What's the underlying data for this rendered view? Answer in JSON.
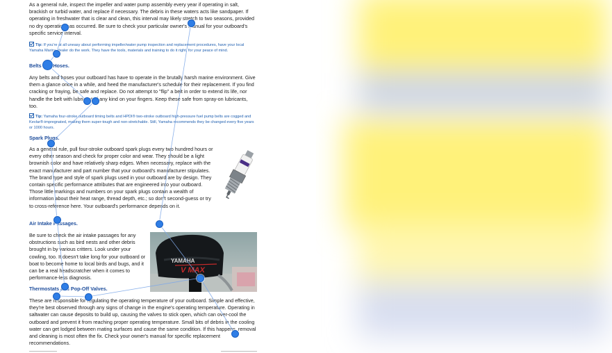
{
  "document": {
    "intro_text": "As a general rule, inspect the impeller and water pump assembly every year if operating in salt, brackish or turbid water, and replace if necessary. The debris in these waters acts like sandpaper. If operating in freshwater that is clear and clean, this interval may likely stretch to two seasons, provided no dry operation has occurred. Be sure to check your particular owner's manual for your outboard's specific service interval.",
    "tip1_label": "Tip:",
    "tip1_text": "If you're at all uneasy about performing impeller/water pump inspection and replacement procedures, have your local Yamaha Marine dealer do the work. They have the tools, materials and training to do it right, for your peace of mind.",
    "belts_heading": "Belts and Hoses.",
    "belts_text": "Any belts and hoses your outboard has have to operate in the brutally harsh marine environment. Give them a glance once in a while, and heed the manufacturer's schedule for their replacement. If you find cracking or fraying, be safe and replace. Do not attempt to \"flip\" a belt in order to extend its life, nor handle the belt with lubricant of any kind on your fingers. Keep these safe from spray-on lubricants, too.",
    "tip2_label": "Tip:",
    "tip2_text": "Yamaha four-stroke outboard timing belts and HPDI® two-stroke outboard high-pressure fuel pump belts are cogged and Kevlar®-impregnated, making them super-tough and non-stretchable. Still, Yamaha recommends they be changed every five years or 1000 hours.",
    "spark_heading": "Spark Plugs.",
    "spark_text": "As a general rule, pull four-stroke outboard spark plugs every two hundred hours or every other season and check for proper color and wear. They should be a light brownish color and have relatively sharp edges. When necessary, replace with the exact manufacturer and part number that your outboard's manufacturer stipulates. The brand type and style of spark plugs used in your outboard are by design. They contain specific performance attributes that are engineered into your outboard. Those little markings and numbers on your spark plugs contain a wealth of information about their heat range, thread depth, etc.; so don't second-guess or try to cross-reference here. Your outboard's performance depends on it.",
    "air_heading": "Air Intake Passages.",
    "air_text": "Be sure to check the air intake passages for any obstructions such as bird nests and other debris brought in by various critters. Look under your cowling, too. It doesn't take long for your outboard or boat to become home to local birds and bugs, and it can be a real headscratcher when it comes to performance-less diagnosis.",
    "thermo_heading": "Thermostats and Pop-Off Valves.",
    "thermo_text": "These are responsible for regulating the operating temperature of your outboard. Simple and effective, they're best observed through any signs of change in the engine's operating temperature. Operating in saltwater can cause deposits to build up, causing the valves to stick open, which can over-cool the outboard and prevent it from reaching proper operating temperature. Small bits of debris in the cooling water can get lodged between mating surfaces and cause the same condition. If this happens, removal and cleaning is most often the fix. Check your owner's manual for specific replacement recommendations.",
    "engine_brand": "YAMAHA",
    "engine_model": "V MAX",
    "spark_plug_image": "spark-plug-image",
    "engine_image": "yamaha-outboard-engine-image"
  },
  "colors": {
    "heading": "#1f4e9c",
    "tip": "#1f5fb0",
    "marker": "#2f7ee6",
    "blur_yellow": "#fff27a",
    "blur_blue": "#c9d3ea"
  }
}
